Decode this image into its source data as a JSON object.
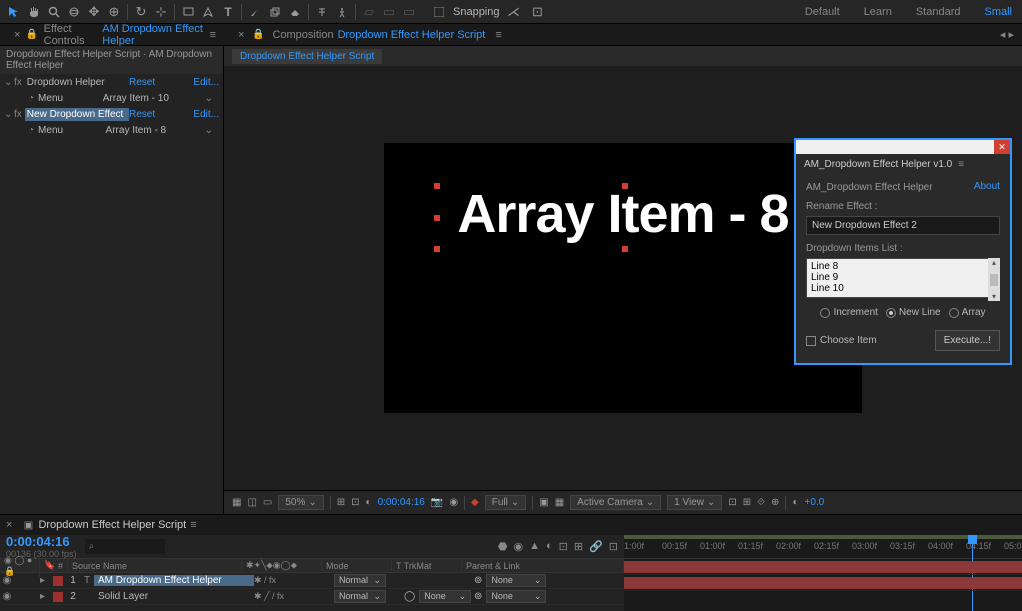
{
  "toolbar": {
    "snapping_label": "Snapping"
  },
  "workspaces": [
    "Default",
    "Learn",
    "Standard",
    "Small"
  ],
  "effect_controls": {
    "panel_label": "Effect Controls",
    "panel_link": "AM Dropdown Effect Helper",
    "header": "Dropdown Effect Helper Script · AM Dropdown Effect Helper",
    "effects": [
      {
        "name": "Dropdown Helper",
        "reset": "Reset",
        "edit": "Edit...",
        "menu_label": "Menu",
        "menu_value": "Array Item - 10",
        "selected": false
      },
      {
        "name": "New Dropdown Effect",
        "reset": "Reset",
        "edit": "Edit...",
        "menu_label": "Menu",
        "menu_value": "Array Item - 8",
        "selected": true
      }
    ]
  },
  "composition": {
    "panel_label": "Composition",
    "panel_link": "Dropdown Effect Helper Script",
    "tab": "Dropdown Effect Helper Script",
    "display_text": "Array Item - 8"
  },
  "viewer": {
    "zoom": "50%",
    "timecode": "0:00:04:16",
    "resolution": "Full",
    "camera": "Active Camera",
    "views": "1 View",
    "exposure": "+0.0"
  },
  "script_panel": {
    "title": "AM_Dropdown Effect Helper v1.0",
    "subtitle": "AM_Dropdown Effect Helper",
    "about": "About",
    "rename_label": "Rename Effect :",
    "rename_value": "New Dropdown Effect 2",
    "items_label": "Dropdown Items List :",
    "items_text": "Line 8\nLine 9\nLine 10",
    "radios": [
      "Increment",
      "New Line",
      "Array"
    ],
    "radio_selected": "New Line",
    "choose_label": "Choose Item",
    "execute": "Execute...!"
  },
  "timeline": {
    "tab": "Dropdown Effect Helper Script",
    "timecode": "0:00:04:16",
    "fps": "00136 (30.00 fps)",
    "search_placeholder": "⌕",
    "col_source": "Source Name",
    "col_mode": "Mode",
    "col_trkmat": "T  TrkMat",
    "col_parent": "Parent & Link",
    "layers": [
      {
        "num": "1",
        "color": "#a03030",
        "type": "T",
        "name": "AM Dropdown Effect Helper",
        "selected": true,
        "mode": "Normal",
        "trkmat": "",
        "parent": "None",
        "bar_color": "#8a3838"
      },
      {
        "num": "2",
        "color": "#a03030",
        "type": "",
        "name": "Solid Layer",
        "selected": false,
        "mode": "Normal",
        "trkmat": "None",
        "parent": "None",
        "bar_color": "#8a3838"
      }
    ],
    "ticks": [
      "1:00f",
      "00:15f",
      "01:00f",
      "01:15f",
      "02:00f",
      "02:15f",
      "03:00f",
      "03:15f",
      "04:00f",
      "04:15f",
      "05:0"
    ]
  }
}
